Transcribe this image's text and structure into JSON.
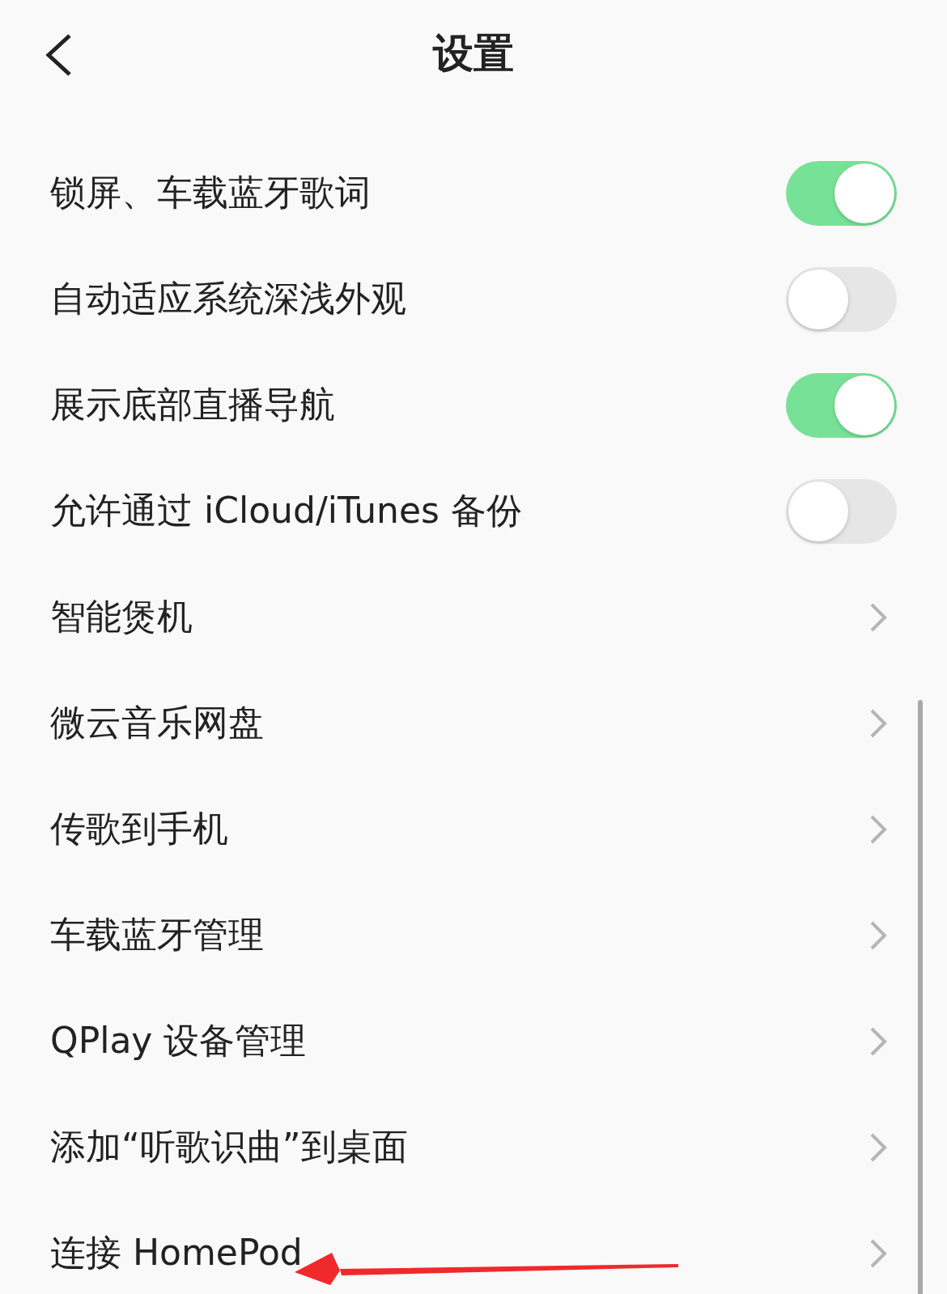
{
  "header": {
    "title": "设置"
  },
  "items": [
    {
      "kind": "toggle",
      "label": "锁屏、车载蓝牙歌词",
      "on": true
    },
    {
      "kind": "toggle",
      "label": "自动适应系统深浅外观",
      "on": false
    },
    {
      "kind": "toggle",
      "label": "展示底部直播导航",
      "on": true
    },
    {
      "kind": "toggle",
      "label": "允许通过 iCloud/iTunes 备份",
      "on": false
    },
    {
      "kind": "link",
      "label": "智能煲机"
    },
    {
      "kind": "link",
      "label": "微云音乐网盘"
    },
    {
      "kind": "link",
      "label": "传歌到手机"
    },
    {
      "kind": "link",
      "label": "车载蓝牙管理"
    },
    {
      "kind": "link",
      "label": "QPlay 设备管理"
    },
    {
      "kind": "link",
      "label": "添加“听歌识曲”到桌面"
    },
    {
      "kind": "link",
      "label": "连接 HomePod"
    }
  ]
}
